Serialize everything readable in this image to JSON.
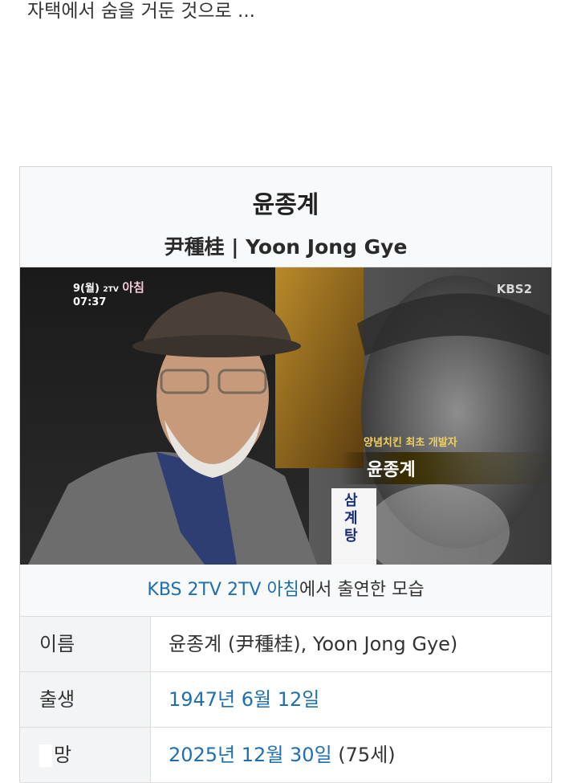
{
  "intro_text": "자택에서 숨을 거둔 것으로 ...",
  "infobox": {
    "name_ko": "윤종계",
    "name_sub": "尹種桂 | Yoon Jong Gye",
    "photo": {
      "broadcaster_mark": "KBS2",
      "show_date": "9(월)",
      "show_time": "07:37",
      "show_channel": "2TV",
      "show_title": "아침",
      "overlay_subtitle": "양념치킨 최초 개발자",
      "overlay_name": "윤종계",
      "sign_text": "삼계탕"
    },
    "caption": {
      "link_text": "KBS 2TV 2TV 아침",
      "rest_text": "에서 출연한 모습"
    },
    "rows": [
      {
        "label": "이름",
        "value": "윤종계 (尹種桂), Yoon Jong Gye)"
      },
      {
        "label": "출생",
        "value": "1947년 6월 12일"
      },
      {
        "label": "망",
        "value_link": "2025년 12월 30일",
        "value_rest": " (75세)"
      }
    ]
  },
  "colors": {
    "link": "#1f6fae",
    "header_bg": "#f8f9fa",
    "label_bg": "#f3f4f6",
    "border": "#dcdcdc"
  }
}
